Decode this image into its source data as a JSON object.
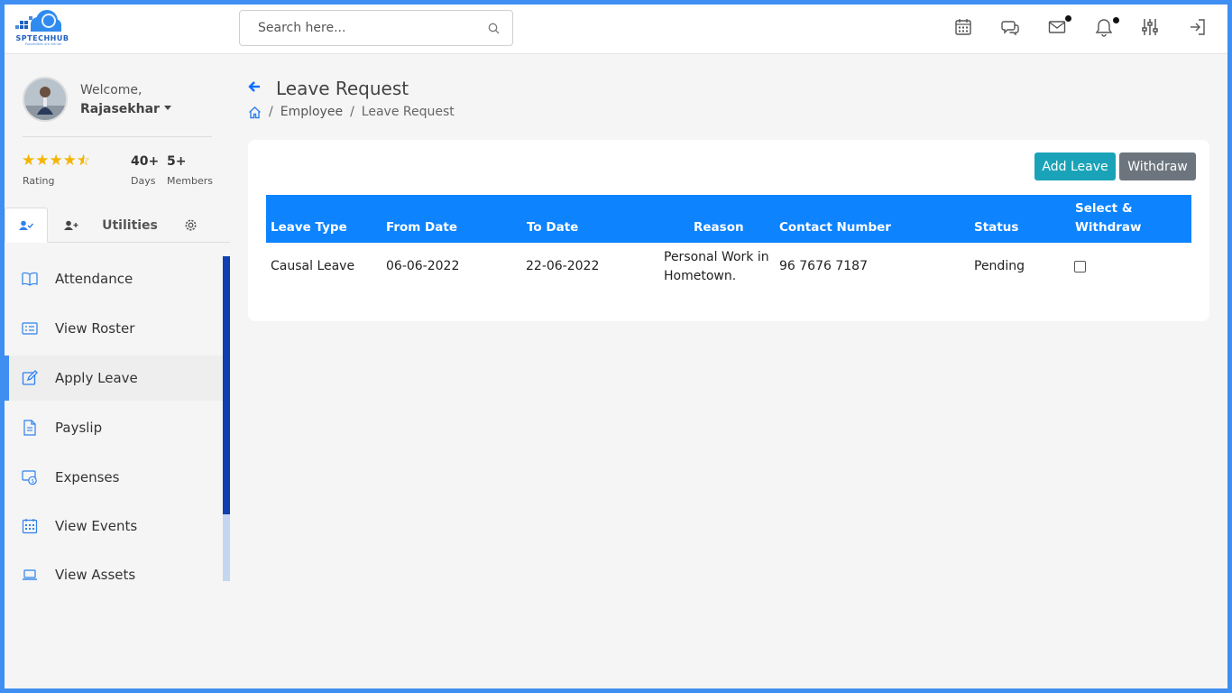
{
  "brand": {
    "name": "SPTECHHUB",
    "tagline": "Possibilities are infinite"
  },
  "search": {
    "placeholder": "Search here..."
  },
  "top_icons": [
    "calendar-icon",
    "chat-icon",
    "mail-icon",
    "bell-icon",
    "sliders-icon",
    "logout-icon"
  ],
  "profile": {
    "welcome": "Welcome,",
    "name": "Rajasekhar",
    "rating_label": "Rating",
    "rating_stars": 4.5,
    "days_value": "40+",
    "days_label": "Days",
    "members_value": "5+",
    "members_label": "Members"
  },
  "tabs": {
    "utilities": "Utilities"
  },
  "menu": [
    {
      "label": "Attendance",
      "icon": "book-icon"
    },
    {
      "label": "View Roster",
      "icon": "roster-icon"
    },
    {
      "label": "Apply Leave",
      "icon": "edit-icon",
      "active": true
    },
    {
      "label": "Payslip",
      "icon": "document-icon"
    },
    {
      "label": "Expenses",
      "icon": "expenses-icon"
    },
    {
      "label": "View Events",
      "icon": "calendar-icon"
    },
    {
      "label": "View Assets",
      "icon": "laptop-icon"
    }
  ],
  "page": {
    "title": "Leave Request",
    "breadcrumb": {
      "employee": "Employee",
      "current": "Leave Request"
    }
  },
  "actions": {
    "add_leave": "Add Leave",
    "withdraw": "Withdraw"
  },
  "table": {
    "headers": {
      "leave_type": "Leave Type",
      "from_date": "From Date",
      "to_date": "To Date",
      "reason": "Reason",
      "contact": "Contact Number",
      "status": "Status",
      "select_line1": "Select &",
      "select_line2": "Withdraw"
    },
    "rows": [
      {
        "leave_type": "Causal Leave",
        "from_date": "06-06-2022",
        "to_date": "22-06-2022",
        "reason_line1": "Personal Work in",
        "reason_line2": "Hometown.",
        "contact": "96 7676 7187",
        "status": "Pending",
        "selected": false
      }
    ]
  },
  "colors": {
    "accent": "#0d83fd",
    "frame": "#3f8ef2",
    "teal": "#1aa3b8",
    "gray": "#6c757d",
    "star": "#f5b400",
    "scroll": "#0f3fb0"
  }
}
